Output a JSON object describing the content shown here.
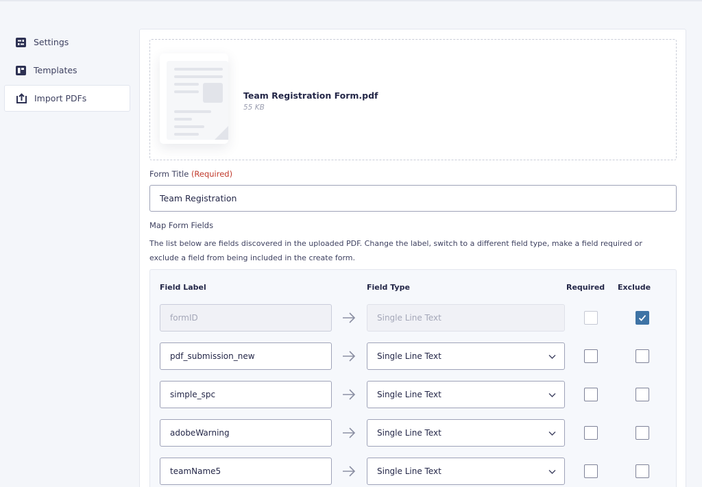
{
  "sidebar": {
    "items": [
      {
        "label": "Settings",
        "icon": "settings-sliders-icon",
        "active": false
      },
      {
        "label": "Templates",
        "icon": "templates-icon",
        "active": false
      },
      {
        "label": "Import PDFs",
        "icon": "upload-icon",
        "active": true
      }
    ]
  },
  "upload": {
    "file_name": "Team Registration Form.pdf",
    "file_size": "55 KB"
  },
  "form_title": {
    "label": "Form Title",
    "required_text": "(Required)",
    "value": "Team Registration"
  },
  "mapping": {
    "heading": "Map Form Fields",
    "description": "The list below are fields discovered in the uploaded PDF. Change the label, switch to a different field type, make a field required or exclude a field from being included in the create form.",
    "columns": {
      "label": "Field Label",
      "type": "Field Type",
      "required": "Required",
      "exclude": "Exclude"
    },
    "rows": [
      {
        "label": "formID",
        "type": "Single Line Text",
        "required": false,
        "exclude": true,
        "disabled": true
      },
      {
        "label": "pdf_submission_new",
        "type": "Single Line Text",
        "required": false,
        "exclude": false,
        "disabled": false
      },
      {
        "label": "simple_spc",
        "type": "Single Line Text",
        "required": false,
        "exclude": false,
        "disabled": false
      },
      {
        "label": "adobeWarning",
        "type": "Single Line Text",
        "required": false,
        "exclude": false,
        "disabled": false
      },
      {
        "label": "teamName5",
        "type": "Single Line Text",
        "required": false,
        "exclude": false,
        "disabled": false
      }
    ]
  },
  "colors": {
    "accent": "#3e73a5",
    "required": "#c0392b",
    "background": "#f4f6fa"
  }
}
